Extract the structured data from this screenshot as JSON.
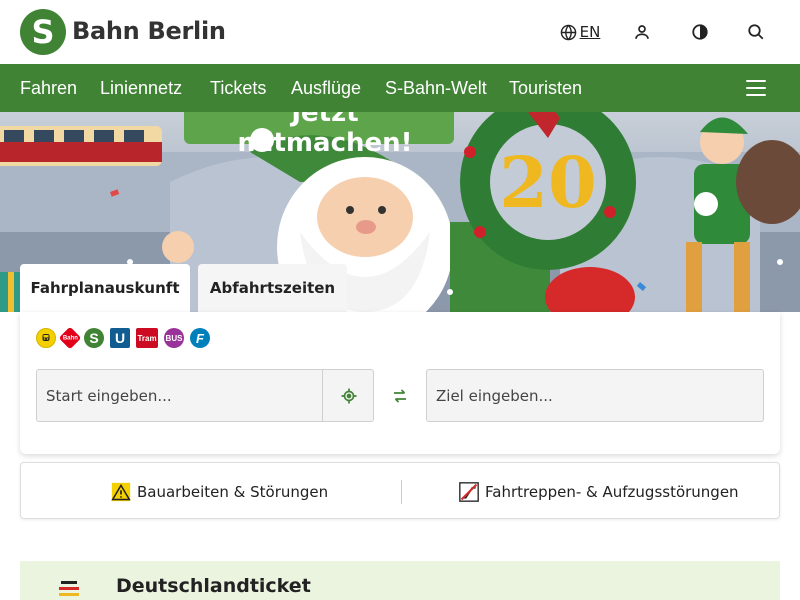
{
  "header": {
    "brand": "Bahn Berlin",
    "logo_letter": "S",
    "language": "EN",
    "icons": [
      "globe-icon",
      "user-icon",
      "contrast-icon",
      "search-icon"
    ]
  },
  "nav": {
    "items": [
      {
        "label": "Fahren"
      },
      {
        "label": "Liniennetz"
      },
      {
        "label": "Tickets"
      },
      {
        "label": "Ausflüge"
      },
      {
        "label": "S-Bahn-Welt"
      },
      {
        "label": "Touristen"
      }
    ]
  },
  "hero": {
    "banner_text": "Jetzt mitmachen!",
    "badge_number": "20"
  },
  "planner": {
    "tabs": [
      {
        "label": "Fahrplanauskunft",
        "active": true
      },
      {
        "label": "Abfahrtszeiten",
        "active": false
      }
    ],
    "modes": [
      {
        "name": "taxi-icon",
        "label": "",
        "color": "#f5d000"
      },
      {
        "name": "bahn-icon",
        "label": "Bahn",
        "color": "#e2001a"
      },
      {
        "name": "sbahn-icon",
        "label": "S",
        "color": "#408335"
      },
      {
        "name": "ubahn-icon",
        "label": "U",
        "color": "#115d91"
      },
      {
        "name": "tram-icon",
        "label": "Tram",
        "color": "#cc0a22"
      },
      {
        "name": "bus-icon",
        "label": "BUS",
        "color": "#993399"
      },
      {
        "name": "ferry-icon",
        "label": "F",
        "color": "#0080ba"
      }
    ],
    "start_placeholder": "Start eingeben...",
    "start_value": "",
    "end_placeholder": "Ziel eingeben...",
    "end_value": ""
  },
  "disruptions": {
    "construction_label": "Bauarbeiten & Störungen",
    "escalator_label": "Fahrtreppen- & Aufzugsstörungen"
  },
  "teaser": {
    "title": "Deutschlandticket"
  },
  "colors": {
    "brand_green": "#408335",
    "teaser_bg": "#eaf4df"
  }
}
